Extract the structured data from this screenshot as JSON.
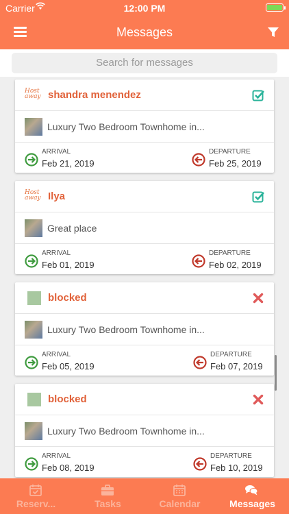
{
  "status_bar": {
    "carrier": "Carrier",
    "time": "12:00 PM",
    "battery_level": 1.0
  },
  "nav": {
    "title": "Messages",
    "menu_icon": "menu-icon",
    "filter_icon": "filter-icon"
  },
  "search": {
    "placeholder": "Search for messages"
  },
  "messages": [
    {
      "guest": "shandra menendez",
      "logo_text": "Host away",
      "listing": "Luxury Two Bedroom Townhome in...",
      "status_icon": "checkbox-checked-icon",
      "arrival_label": "ARRIVAL",
      "arrival": "Feb 21, 2019",
      "departure_label": "DEPARTURE",
      "departure": "Feb 25, 2019"
    },
    {
      "guest": "Ilya",
      "logo_text": "Host away",
      "listing": "Great place",
      "status_icon": "checkbox-checked-icon",
      "arrival_label": "ARRIVAL",
      "arrival": "Feb 01, 2019",
      "departure_label": "DEPARTURE",
      "departure": "Feb 02, 2019"
    },
    {
      "guest": "blocked",
      "logo_text": "",
      "listing": "Luxury Two Bedroom Townhome in...",
      "status_icon": "x-icon",
      "arrival_label": "ARRIVAL",
      "arrival": "Feb 05, 2019",
      "departure_label": "DEPARTURE",
      "departure": "Feb 07, 2019"
    },
    {
      "guest": "blocked",
      "logo_text": "",
      "listing": "Luxury Two Bedroom Townhome in...",
      "status_icon": "x-icon",
      "arrival_label": "ARRIVAL",
      "arrival": "Feb 08, 2019",
      "departure_label": "DEPARTURE",
      "departure": "Feb 10, 2019"
    }
  ],
  "tabs": [
    {
      "label": "Reserv...",
      "icon": "calendar-check-icon",
      "active": false
    },
    {
      "label": "Tasks",
      "icon": "briefcase-icon",
      "active": false
    },
    {
      "label": "Calendar",
      "icon": "calendar-icon",
      "active": false
    },
    {
      "label": "Messages",
      "icon": "chat-icon",
      "active": true
    }
  ],
  "colors": {
    "brand": "#fc7b52",
    "guest_name": "#e1623a",
    "arrival": "#3f9b3f",
    "departure": "#c0392b",
    "check": "#2ab39a",
    "cross": "#e05a5a"
  }
}
